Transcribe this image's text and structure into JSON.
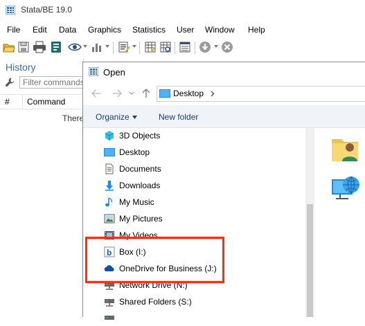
{
  "app": {
    "title": "Stata/BE 19.0",
    "menu": [
      "File",
      "Edit",
      "Data",
      "Graphics",
      "Statistics",
      "User",
      "Window",
      "Help"
    ]
  },
  "toolbar": {
    "icons": [
      "open-icon",
      "save-icon",
      "print-icon",
      "log-icon",
      "viewer-icon",
      "graph-icon",
      "do-file-editor-icon",
      "data-editor-icon",
      "data-browser-icon",
      "variables-manager-icon",
      "more-icon",
      "break-icon"
    ]
  },
  "history": {
    "title": "History",
    "filter_placeholder": "Filter commands here",
    "col_num": "#",
    "col_command": "Command",
    "empty_text": "There are no items to show."
  },
  "dialog": {
    "title": "Open",
    "address": "Desktop",
    "organize_label": "Organize",
    "new_folder_label": "New folder",
    "nav_items": [
      {
        "label": "3D Objects",
        "icon": "3d-objects-icon"
      },
      {
        "label": "Desktop",
        "icon": "desktop-icon"
      },
      {
        "label": "Documents",
        "icon": "documents-icon"
      },
      {
        "label": "Downloads",
        "icon": "downloads-icon"
      },
      {
        "label": "My Music",
        "icon": "music-icon"
      },
      {
        "label": "My Pictures",
        "icon": "pictures-icon"
      },
      {
        "label": "My Videos",
        "icon": "videos-icon"
      },
      {
        "label": "Box (I:)",
        "icon": "box-drive-icon"
      },
      {
        "label": "OneDrive for Business (J:)",
        "icon": "onedrive-icon"
      },
      {
        "label": "Network Drive (N:)",
        "icon": "network-drive-icon"
      },
      {
        "label": "Shared Folders (S:)",
        "icon": "network-drive-icon"
      },
      {
        "label": "",
        "icon": "network-drive-icon"
      }
    ]
  },
  "colors": {
    "accent": "#3b6fb5",
    "highlight_box": "#ff2f14",
    "command_bar_bg": "#f0f4f9"
  }
}
